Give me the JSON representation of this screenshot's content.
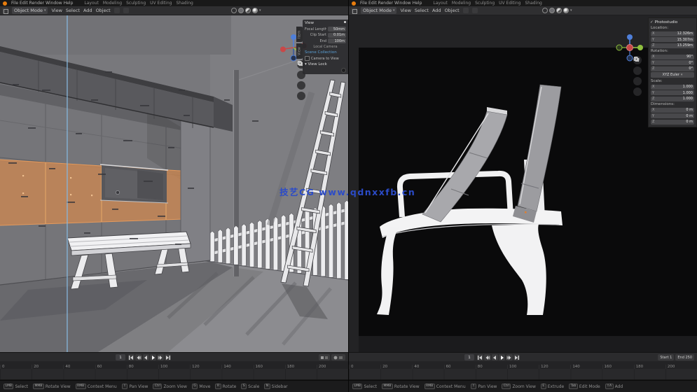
{
  "colors": {
    "selection_orange": "#cb8752",
    "guide_blue": "#85b6dc",
    "watermark_blue": "#2b4bc8",
    "axis_x_red": "#c94848",
    "axis_y_green": "#8fbf3f",
    "axis_z_blue": "#4f7fd9",
    "blender_logo_orange": "#e87d0d"
  },
  "watermark": {
    "text": "技艺CG  www.qdnxxfb.cn"
  },
  "topbar": {
    "menus": [
      "File",
      "Edit",
      "Render",
      "Window",
      "Help"
    ],
    "tabs": [
      "Layout",
      "Modeling",
      "Sculpting",
      "UV Editing",
      "Shading"
    ]
  },
  "vheader": {
    "mode": "Object Mode",
    "menus": [
      "View",
      "Select",
      "Add",
      "Object"
    ]
  },
  "left_window": {
    "sidebar": {
      "tabs": [
        "Item",
        "View"
      ],
      "title": "View",
      "fields": [
        {
          "label": "Focal Length",
          "value": "50mm"
        },
        {
          "label": "Clip Start",
          "value": "0.01m"
        },
        {
          "label": "End",
          "value": "100m"
        }
      ],
      "subrow": "Local Camera",
      "link": "Scene Collection",
      "checkbox": "Camera to View",
      "section2": "View Lock"
    },
    "timeline": {
      "current": "1",
      "frames": [
        "0",
        "20",
        "40",
        "60",
        "80",
        "100",
        "120",
        "140",
        "160",
        "180",
        "200"
      ]
    },
    "status": [
      {
        "key": "LMB",
        "text": "Select"
      },
      {
        "key": "MMB",
        "text": "Rotate View"
      },
      {
        "key": "RMB",
        "text": "Context Menu"
      },
      {
        "key": "⇧",
        "text": "Pan View"
      },
      {
        "key": "Ctrl",
        "text": "Zoom View"
      },
      {
        "key": "G",
        "text": "Move"
      },
      {
        "key": "R",
        "text": "Rotate"
      },
      {
        "key": "S",
        "text": "Scale"
      },
      {
        "key": "N",
        "text": "Sidebar"
      }
    ]
  },
  "right_window": {
    "sidebar": {
      "tab": "Item",
      "object_checkbox": "Photostudio",
      "sections": [
        {
          "title": "Location:",
          "rows": [
            {
              "axis": "X",
              "value": "12.326m"
            },
            {
              "axis": "Y",
              "value": "15.307m"
            },
            {
              "axis": "Z",
              "value": "13.259m"
            }
          ]
        },
        {
          "title": "Rotation:",
          "rows": [
            {
              "axis": "X",
              "value": "90°"
            },
            {
              "axis": "Y",
              "value": "0°"
            },
            {
              "axis": "Z",
              "value": "0°"
            }
          ]
        },
        {
          "title": "Scale:",
          "rows": [
            {
              "axis": "X",
              "value": "1.000"
            },
            {
              "axis": "Y",
              "value": "1.000"
            },
            {
              "axis": "Z",
              "value": "1.000"
            }
          ]
        },
        {
          "title": "Dimensions:",
          "rows": [
            {
              "axis": "X",
              "value": "0 m"
            },
            {
              "axis": "Y",
              "value": "0 m"
            },
            {
              "axis": "Z",
              "value": "0 m"
            }
          ]
        }
      ],
      "rotation_mode": "XYZ Euler"
    },
    "timeline": {
      "current": "1",
      "frames": [
        "0",
        "20",
        "40",
        "60",
        "80",
        "100",
        "120",
        "140",
        "160",
        "180",
        "200"
      ],
      "start": "Start 1",
      "end": "End 250"
    },
    "status": [
      {
        "key": "LMB",
        "text": "Select"
      },
      {
        "key": "MMB",
        "text": "Rotate View"
      },
      {
        "key": "RMB",
        "text": "Context Menu"
      },
      {
        "key": "⇧",
        "text": "Pan View"
      },
      {
        "key": "Ctrl",
        "text": "Zoom View"
      },
      {
        "key": "E",
        "text": "Extrude"
      },
      {
        "key": "Tab",
        "text": "Edit Mode"
      },
      {
        "key": "⇧A",
        "text": "Add"
      }
    ]
  }
}
